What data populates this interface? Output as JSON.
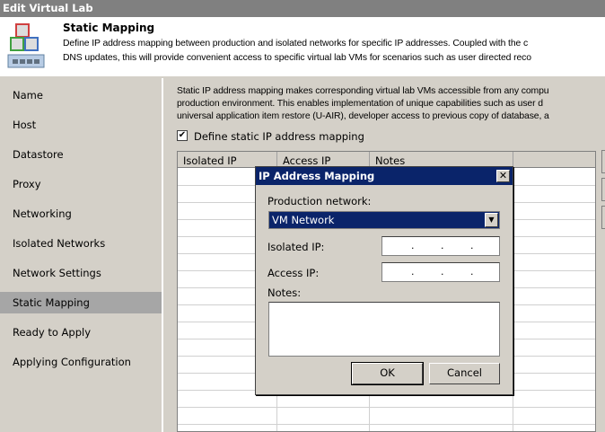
{
  "window": {
    "title": "Edit Virtual Lab"
  },
  "header": {
    "title": "Static Mapping",
    "desc_line1": "Define IP address mapping between production and isolated networks for specific IP addresses. Coupled with the c",
    "desc_line2": "DNS updates, this will provide convenient access to specific virtual lab VMs for scenarios such as user directed reco"
  },
  "sidebar": {
    "items": [
      {
        "label": "Name"
      },
      {
        "label": "Host"
      },
      {
        "label": "Datastore"
      },
      {
        "label": "Proxy"
      },
      {
        "label": "Networking"
      },
      {
        "label": "Isolated Networks"
      },
      {
        "label": "Network Settings"
      },
      {
        "label": "Static Mapping",
        "selected": true
      },
      {
        "label": "Ready to Apply"
      },
      {
        "label": "Applying Configuration"
      }
    ]
  },
  "main": {
    "desc_line1": "Static IP address mapping makes corresponding virtual lab VMs accessible from any compu",
    "desc_line2": "production environment. This enables implementation of unique capabilities such as user d",
    "desc_line3": "universal application item restore (U-AIR), developer access to previous copy of database, a",
    "checkbox_label": "Define static IP address mapping",
    "checkbox_checked": true,
    "columns": [
      "Isolated IP",
      "Access IP",
      "Notes"
    ]
  },
  "dialog": {
    "title": "IP Address Mapping",
    "production_network_label": "Production network:",
    "production_network_value": "VM Network",
    "isolated_ip_label": "Isolated IP:",
    "access_ip_label": "Access IP:",
    "notes_label": "Notes:",
    "ok_label": "OK",
    "cancel_label": "Cancel"
  },
  "colors": {
    "selection": "#0a246a",
    "titlebar": "#808080"
  }
}
